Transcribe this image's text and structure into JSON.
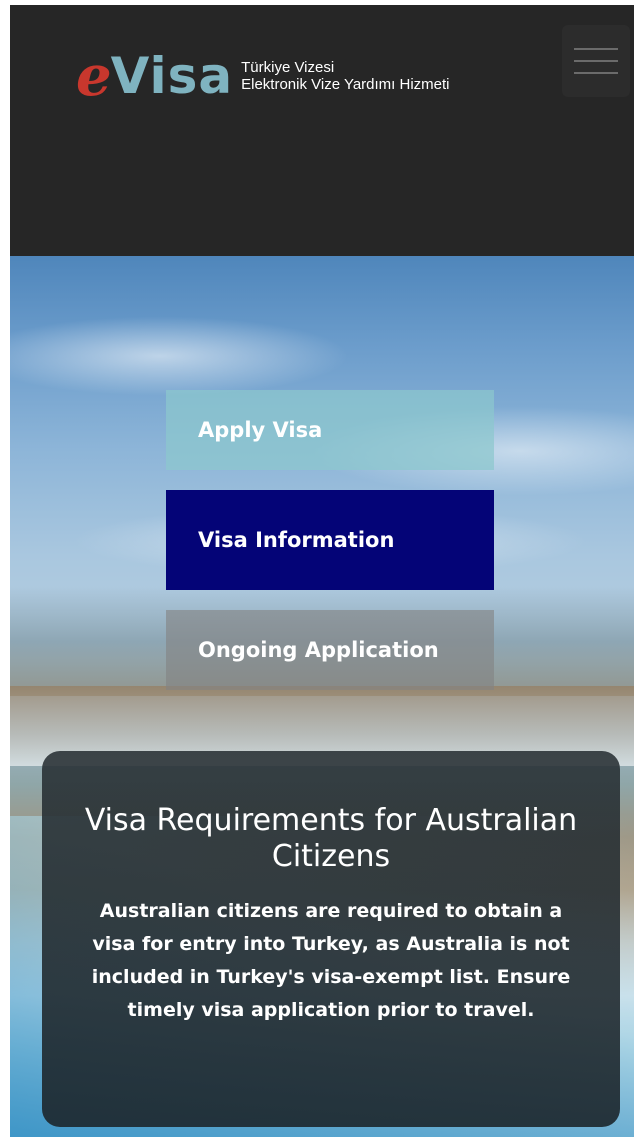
{
  "header": {
    "logo": {
      "brand_e": "e",
      "brand_visa": "Visa",
      "tagline_line1": "Türkiye Vizesi",
      "tagline_line2": "Elektronik Vize Yardımı Hizmeti",
      "colors": {
        "e": "#c8372d",
        "visa": "#7fb3c0"
      }
    },
    "menu_icon": "hamburger-menu-icon",
    "background": "#262626"
  },
  "hero": {
    "buttons": {
      "apply": "Apply Visa",
      "info": "Visa Information",
      "ongoing": "Ongoing Application"
    },
    "button_colors": {
      "apply": "#8cc8cd",
      "info": "#040477",
      "ongoing": "#828282"
    }
  },
  "card": {
    "title": "Visa Requirements for Australian Citizens",
    "body": "Australian citizens are required to obtain a visa for entry into Turkey, as Australia is not included in Turkey's visa-exempt list. Ensure timely visa application prior to travel."
  }
}
